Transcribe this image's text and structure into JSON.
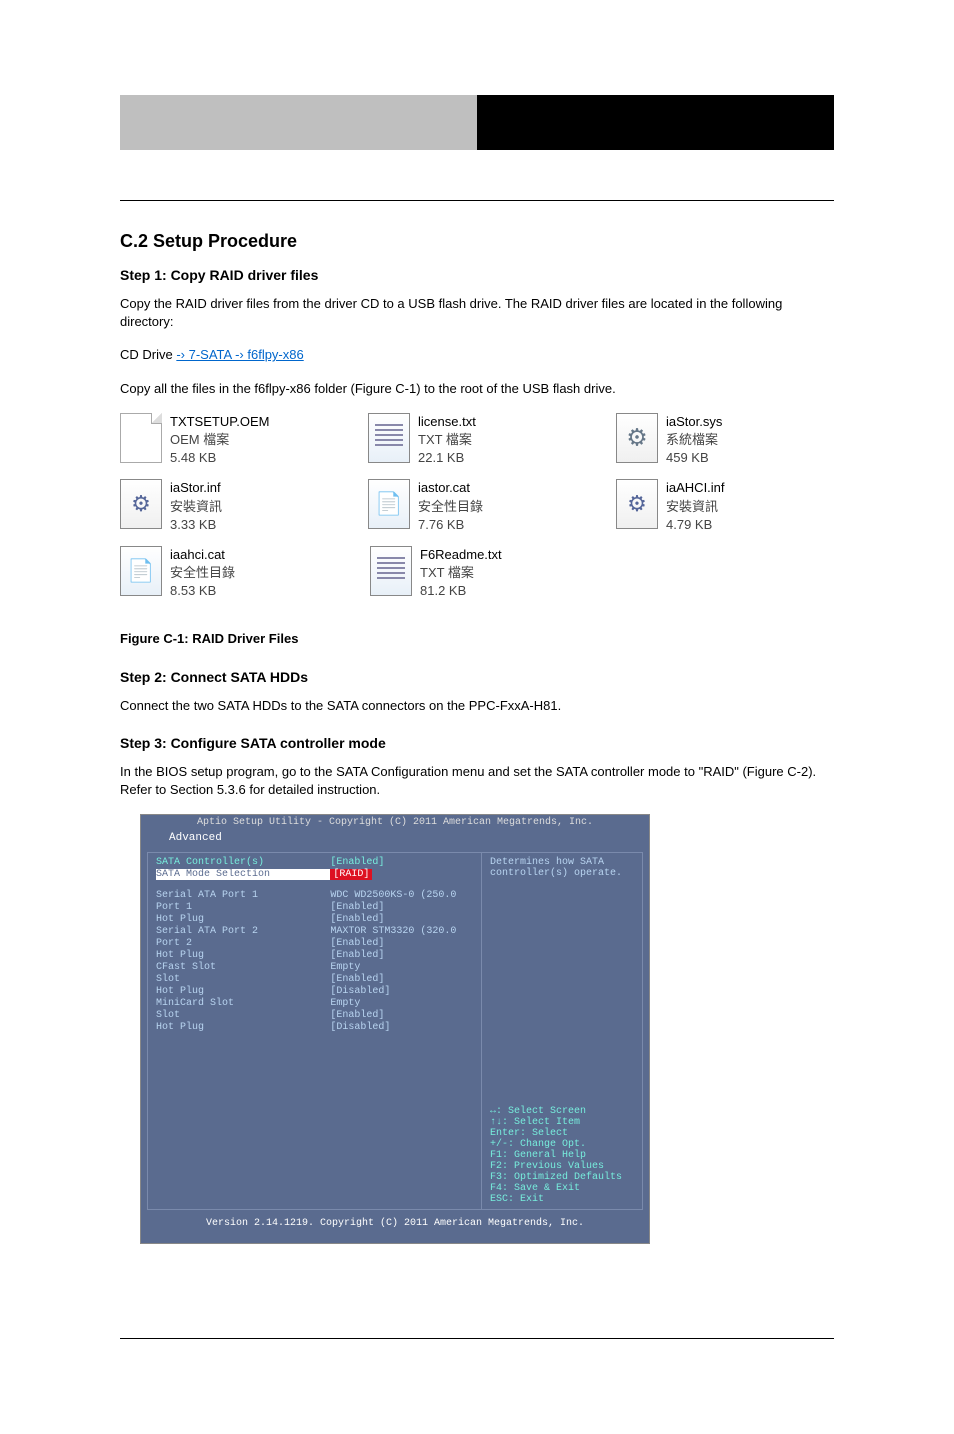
{
  "section_heading": "C.2 Setup Procedure",
  "step1": {
    "label": "Step 1: Copy RAID driver files",
    "para": "Copy the RAID driver files from the driver CD to a USB flash drive. The RAID driver files are located in the following directory:",
    "path_prefix": "CD Drive ",
    "path_link": "-› 7-SATA -› f6flpy-x86",
    "para2": "Copy all the files in the f6flpy-x86 folder (Figure C-1) to the root of the USB flash drive."
  },
  "files": {
    "row1": [
      {
        "name": "TXTSETUP.OEM",
        "type": "OEM 檔案",
        "size": "5.48 KB",
        "icon": "blank"
      },
      {
        "name": "license.txt",
        "type": "TXT 檔案",
        "size": "22.1 KB",
        "icon": "txt"
      },
      {
        "name": "iaStor.sys",
        "type": "系統檔案",
        "size": "459 KB",
        "icon": "sys"
      }
    ],
    "row2": [
      {
        "name": "iaStor.inf",
        "type": "安裝資訊",
        "size": "3.33 KB",
        "icon": "inf"
      },
      {
        "name": "iastor.cat",
        "type": "安全性目錄",
        "size": "7.76 KB",
        "icon": "cat"
      },
      {
        "name": "iaAHCI.inf",
        "type": "安裝資訊",
        "size": "4.79 KB",
        "icon": "inf"
      }
    ],
    "row3": [
      {
        "name": "iaahci.cat",
        "type": "安全性目錄",
        "size": "8.53 KB",
        "icon": "cat"
      },
      {
        "name": "F6Readme.txt",
        "type": "TXT 檔案",
        "size": "81.2 KB",
        "icon": "txt"
      }
    ]
  },
  "fig1_caption": "Figure C-1: RAID Driver Files",
  "step2": {
    "label": "Step 2: Connect SATA HDDs",
    "para": "Connect the two SATA HDDs to the SATA connectors on the PPC-FxxA-H81."
  },
  "step3": {
    "label": "Step 3: Configure SATA controller mode",
    "para": "In the BIOS setup program, go to the SATA Configuration menu and set the SATA controller mode to \"RAID\" (Figure C-2). Refer to Section 5.3.6 for detailed instruction."
  },
  "bios": {
    "title": "Aptio Setup Utility - Copyright (C) 2011 American Megatrends, Inc.",
    "tab": "Advanced",
    "rows": [
      {
        "label": "SATA Controller(s)",
        "value": "[Enabled]",
        "cls": ""
      },
      {
        "label": "SATA Mode Selection",
        "value": "[RAID]",
        "cls": "sel"
      },
      {
        "label": "",
        "value": "",
        "cls": "sp"
      },
      {
        "label": "Serial ATA Port 1",
        "value": "WDC WD2500KS-0 (250.0",
        "cls": ""
      },
      {
        "label": "  Port 1",
        "value": "[Enabled]",
        "cls": ""
      },
      {
        "label": "  Hot Plug",
        "value": "[Enabled]",
        "cls": ""
      },
      {
        "label": "Serial ATA Port 2",
        "value": "MAXTOR STM3320 (320.0",
        "cls": ""
      },
      {
        "label": "  Port 2",
        "value": "[Enabled]",
        "cls": ""
      },
      {
        "label": "  Hot Plug",
        "value": "[Enabled]",
        "cls": ""
      },
      {
        "label": "CFast Slot",
        "value": "Empty",
        "cls": ""
      },
      {
        "label": "  Slot",
        "value": "[Enabled]",
        "cls": ""
      },
      {
        "label": "  Hot Plug",
        "value": "[Disabled]",
        "cls": ""
      },
      {
        "label": "MiniCard Slot",
        "value": "Empty",
        "cls": ""
      },
      {
        "label": "  Slot",
        "value": "[Enabled]",
        "cls": ""
      },
      {
        "label": "  Hot Plug",
        "value": "[Disabled]",
        "cls": ""
      }
    ],
    "help_top": [
      "Determines how SATA",
      "controller(s) operate."
    ],
    "help_bottom": [
      "↔: Select Screen",
      "↑↓: Select Item",
      "Enter: Select",
      "+/-: Change Opt.",
      "F1: General Help",
      "F2: Previous Values",
      "F3: Optimized Defaults",
      "F4: Save & Exit",
      "ESC: Exit"
    ],
    "footer": "Version 2.14.1219. Copyright (C) 2011 American Megatrends, Inc."
  }
}
